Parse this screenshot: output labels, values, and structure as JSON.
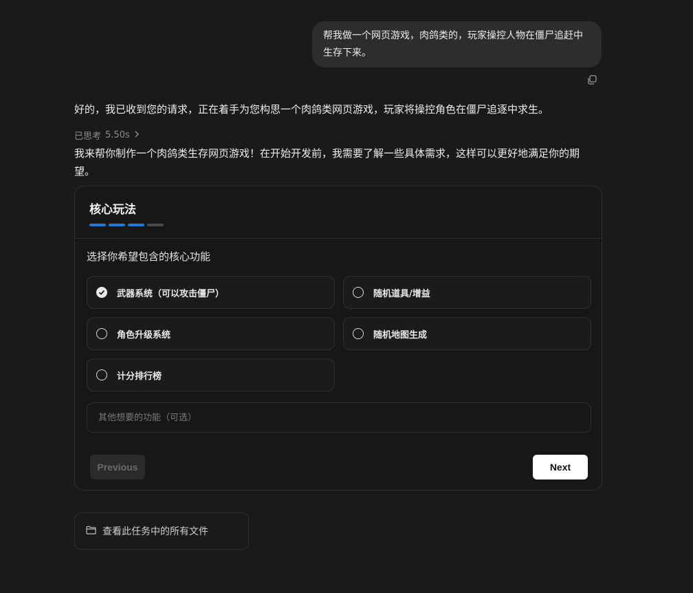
{
  "user_message": "帮我做一个网页游戏，肉鸽类的，玩家操控人物在僵尸追赶中生存下来。",
  "assistant": {
    "reply_1": "好的，我已收到您的请求，正在着手为您构思一个肉鸽类网页游戏，玩家将操控角色在僵尸追逐中求生。",
    "thought_label": "已思考",
    "thought_time": "5.50s",
    "reply_2": "我来帮你制作一个肉鸽类生存网页游戏！在开始开发前，我需要了解一些具体需求，这样可以更好地满足你的期望。"
  },
  "card": {
    "title": "核心玩法",
    "steps_total": 4,
    "steps_done": 3,
    "question": "选择你希望包含的核心功能",
    "options": [
      {
        "label": "武器系统（可以攻击僵尸）",
        "checked": true
      },
      {
        "label": "随机道具/增益",
        "checked": false
      },
      {
        "label": "角色升级系统",
        "checked": false
      },
      {
        "label": "随机地图生成",
        "checked": false
      },
      {
        "label": "计分排行榜",
        "checked": false
      }
    ],
    "other_value": "",
    "other_placeholder": "其他想要的功能（可选）",
    "previous_label": "Previous",
    "next_label": "Next"
  },
  "files_button_label": "查看此任务中的所有文件",
  "colors": {
    "accent": "#1e7ad6",
    "background": "#1a1a1a",
    "bubble": "#2d2d2d"
  }
}
